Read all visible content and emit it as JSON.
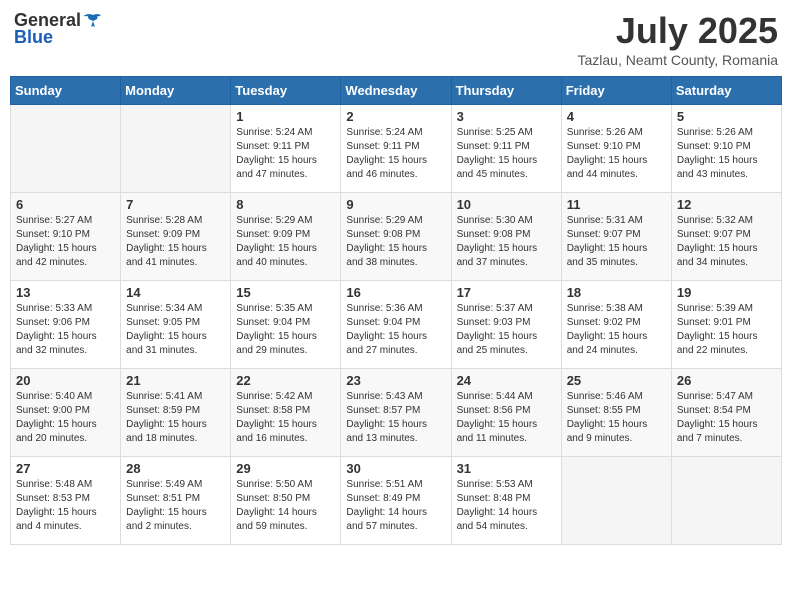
{
  "header": {
    "logo_general": "General",
    "logo_blue": "Blue",
    "title": "July 2025",
    "location": "Tazlau, Neamt County, Romania"
  },
  "calendar": {
    "days_of_week": [
      "Sunday",
      "Monday",
      "Tuesday",
      "Wednesday",
      "Thursday",
      "Friday",
      "Saturday"
    ],
    "weeks": [
      [
        {
          "day": "",
          "info": ""
        },
        {
          "day": "",
          "info": ""
        },
        {
          "day": "1",
          "info": "Sunrise: 5:24 AM\nSunset: 9:11 PM\nDaylight: 15 hours\nand 47 minutes."
        },
        {
          "day": "2",
          "info": "Sunrise: 5:24 AM\nSunset: 9:11 PM\nDaylight: 15 hours\nand 46 minutes."
        },
        {
          "day": "3",
          "info": "Sunrise: 5:25 AM\nSunset: 9:11 PM\nDaylight: 15 hours\nand 45 minutes."
        },
        {
          "day": "4",
          "info": "Sunrise: 5:26 AM\nSunset: 9:10 PM\nDaylight: 15 hours\nand 44 minutes."
        },
        {
          "day": "5",
          "info": "Sunrise: 5:26 AM\nSunset: 9:10 PM\nDaylight: 15 hours\nand 43 minutes."
        }
      ],
      [
        {
          "day": "6",
          "info": "Sunrise: 5:27 AM\nSunset: 9:10 PM\nDaylight: 15 hours\nand 42 minutes."
        },
        {
          "day": "7",
          "info": "Sunrise: 5:28 AM\nSunset: 9:09 PM\nDaylight: 15 hours\nand 41 minutes."
        },
        {
          "day": "8",
          "info": "Sunrise: 5:29 AM\nSunset: 9:09 PM\nDaylight: 15 hours\nand 40 minutes."
        },
        {
          "day": "9",
          "info": "Sunrise: 5:29 AM\nSunset: 9:08 PM\nDaylight: 15 hours\nand 38 minutes."
        },
        {
          "day": "10",
          "info": "Sunrise: 5:30 AM\nSunset: 9:08 PM\nDaylight: 15 hours\nand 37 minutes."
        },
        {
          "day": "11",
          "info": "Sunrise: 5:31 AM\nSunset: 9:07 PM\nDaylight: 15 hours\nand 35 minutes."
        },
        {
          "day": "12",
          "info": "Sunrise: 5:32 AM\nSunset: 9:07 PM\nDaylight: 15 hours\nand 34 minutes."
        }
      ],
      [
        {
          "day": "13",
          "info": "Sunrise: 5:33 AM\nSunset: 9:06 PM\nDaylight: 15 hours\nand 32 minutes."
        },
        {
          "day": "14",
          "info": "Sunrise: 5:34 AM\nSunset: 9:05 PM\nDaylight: 15 hours\nand 31 minutes."
        },
        {
          "day": "15",
          "info": "Sunrise: 5:35 AM\nSunset: 9:04 PM\nDaylight: 15 hours\nand 29 minutes."
        },
        {
          "day": "16",
          "info": "Sunrise: 5:36 AM\nSunset: 9:04 PM\nDaylight: 15 hours\nand 27 minutes."
        },
        {
          "day": "17",
          "info": "Sunrise: 5:37 AM\nSunset: 9:03 PM\nDaylight: 15 hours\nand 25 minutes."
        },
        {
          "day": "18",
          "info": "Sunrise: 5:38 AM\nSunset: 9:02 PM\nDaylight: 15 hours\nand 24 minutes."
        },
        {
          "day": "19",
          "info": "Sunrise: 5:39 AM\nSunset: 9:01 PM\nDaylight: 15 hours\nand 22 minutes."
        }
      ],
      [
        {
          "day": "20",
          "info": "Sunrise: 5:40 AM\nSunset: 9:00 PM\nDaylight: 15 hours\nand 20 minutes."
        },
        {
          "day": "21",
          "info": "Sunrise: 5:41 AM\nSunset: 8:59 PM\nDaylight: 15 hours\nand 18 minutes."
        },
        {
          "day": "22",
          "info": "Sunrise: 5:42 AM\nSunset: 8:58 PM\nDaylight: 15 hours\nand 16 minutes."
        },
        {
          "day": "23",
          "info": "Sunrise: 5:43 AM\nSunset: 8:57 PM\nDaylight: 15 hours\nand 13 minutes."
        },
        {
          "day": "24",
          "info": "Sunrise: 5:44 AM\nSunset: 8:56 PM\nDaylight: 15 hours\nand 11 minutes."
        },
        {
          "day": "25",
          "info": "Sunrise: 5:46 AM\nSunset: 8:55 PM\nDaylight: 15 hours\nand 9 minutes."
        },
        {
          "day": "26",
          "info": "Sunrise: 5:47 AM\nSunset: 8:54 PM\nDaylight: 15 hours\nand 7 minutes."
        }
      ],
      [
        {
          "day": "27",
          "info": "Sunrise: 5:48 AM\nSunset: 8:53 PM\nDaylight: 15 hours\nand 4 minutes."
        },
        {
          "day": "28",
          "info": "Sunrise: 5:49 AM\nSunset: 8:51 PM\nDaylight: 15 hours\nand 2 minutes."
        },
        {
          "day": "29",
          "info": "Sunrise: 5:50 AM\nSunset: 8:50 PM\nDaylight: 14 hours\nand 59 minutes."
        },
        {
          "day": "30",
          "info": "Sunrise: 5:51 AM\nSunset: 8:49 PM\nDaylight: 14 hours\nand 57 minutes."
        },
        {
          "day": "31",
          "info": "Sunrise: 5:53 AM\nSunset: 8:48 PM\nDaylight: 14 hours\nand 54 minutes."
        },
        {
          "day": "",
          "info": ""
        },
        {
          "day": "",
          "info": ""
        }
      ]
    ]
  }
}
